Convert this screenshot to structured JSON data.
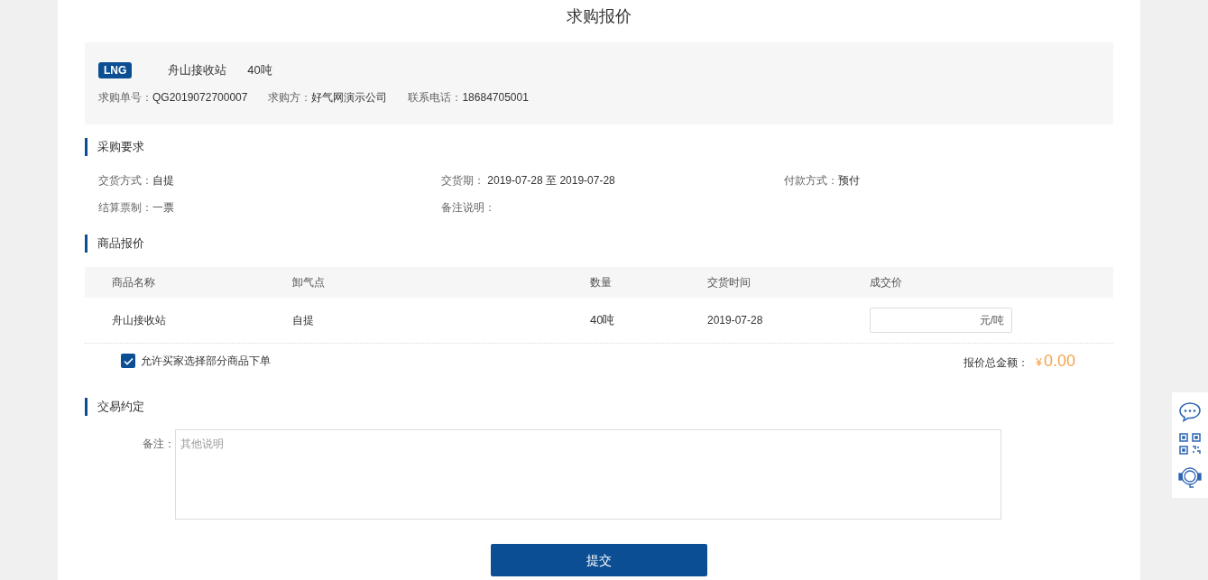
{
  "title": "求购报价",
  "summary": {
    "tag": "LNG",
    "station": "舟山接收站",
    "quantity": "40吨",
    "meta": [
      {
        "label": "求购单号：",
        "value": "QG2019072700007"
      },
      {
        "label": "求购方：",
        "value": "好气网演示公司"
      },
      {
        "label": "联系电话：",
        "value": "18684705001"
      }
    ]
  },
  "requirements": {
    "heading": "采购要求",
    "fields": [
      {
        "label": "交货方式：",
        "value": "自提"
      },
      {
        "label": "交货期：",
        "value": " 2019-07-28 至 2019-07-28"
      },
      {
        "label": "付款方式：",
        "value": "预付"
      },
      {
        "label": "结算票制：",
        "value": "一票"
      },
      {
        "label": "备注说明："
      }
    ]
  },
  "quote": {
    "heading": "商品报价",
    "columns": [
      "商品名称",
      "卸气点",
      "数量",
      "交货时间",
      "成交价"
    ],
    "rows": [
      {
        "name": "舟山接收站",
        "point": "自提",
        "quantity": "40吨",
        "date": "2019-07-28",
        "price_unit": "元/吨"
      }
    ],
    "allow_partial": {
      "label": "允许买家选择部分商品下单",
      "checked": true
    },
    "total_label": "报价总金额：",
    "currency": "¥",
    "total": "0.00"
  },
  "agreement": {
    "heading": "交易约定",
    "remark_label": "备注：",
    "remark_placeholder": "其他说明"
  },
  "submit": "提交"
}
